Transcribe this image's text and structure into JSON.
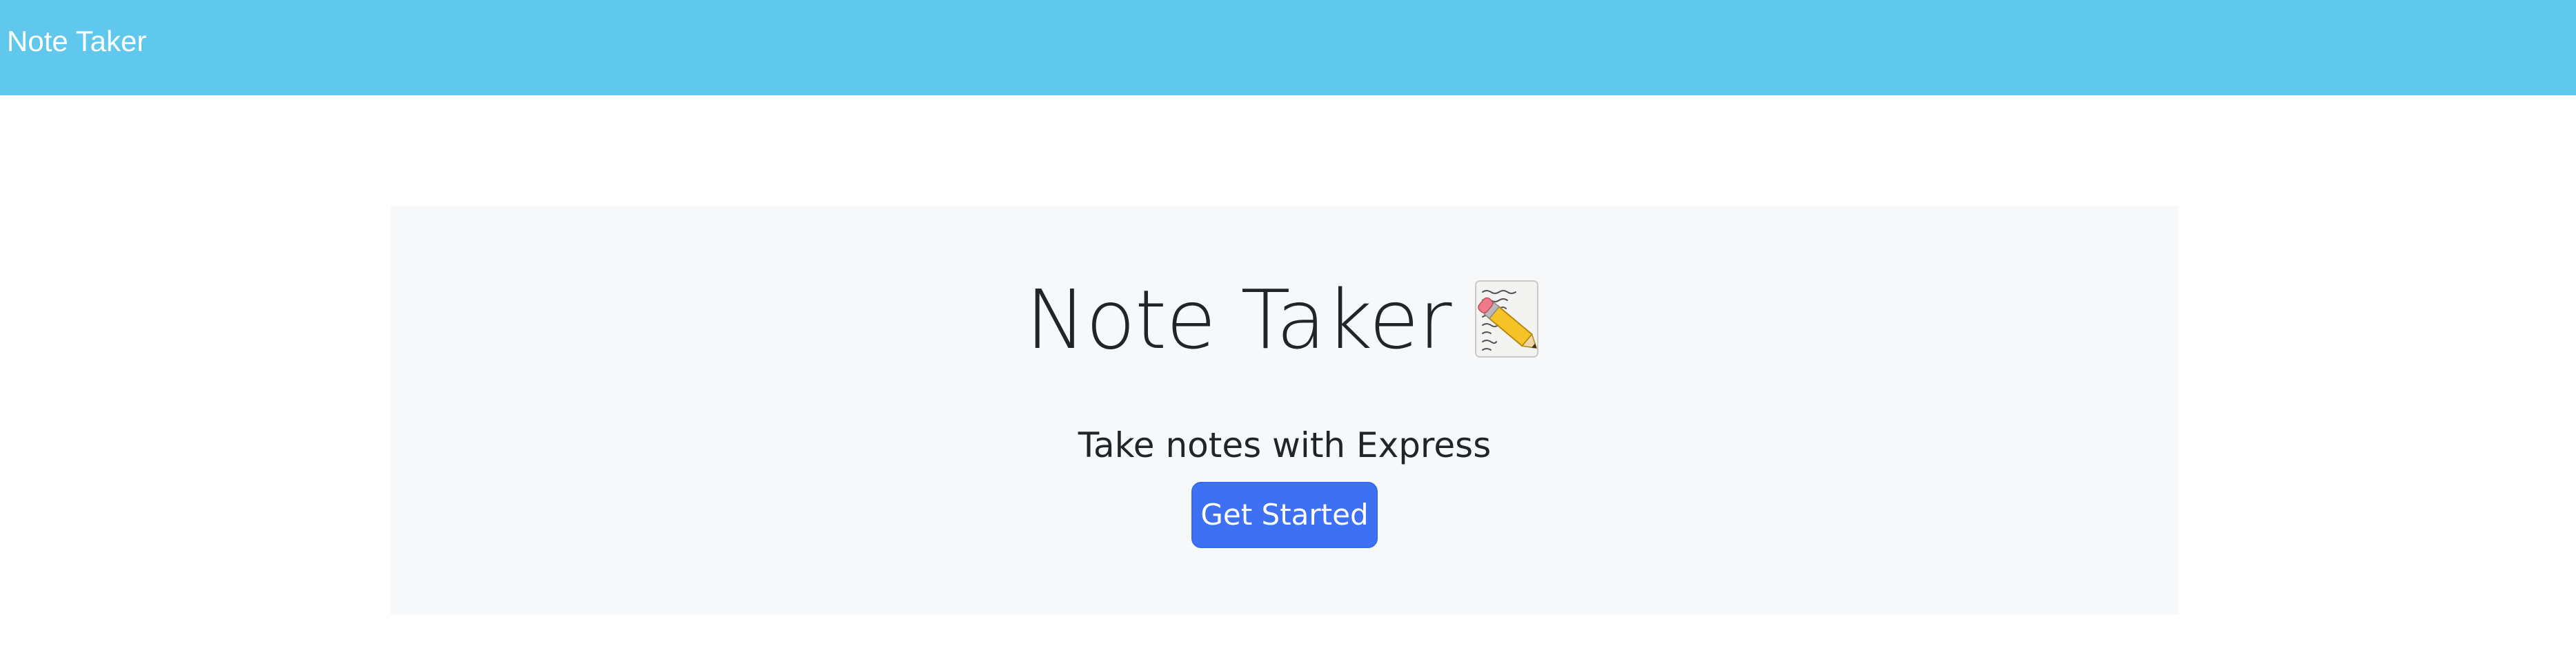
{
  "navbar": {
    "brand": "Note Taker",
    "background_color": "#5fc8ec"
  },
  "hero": {
    "title": "Note Taker",
    "title_icon": "memo-icon",
    "subtitle": "Take notes with Express",
    "cta_label": "Get Started",
    "cta_color": "#3d70f3",
    "background_color": "#f7f8fa"
  }
}
